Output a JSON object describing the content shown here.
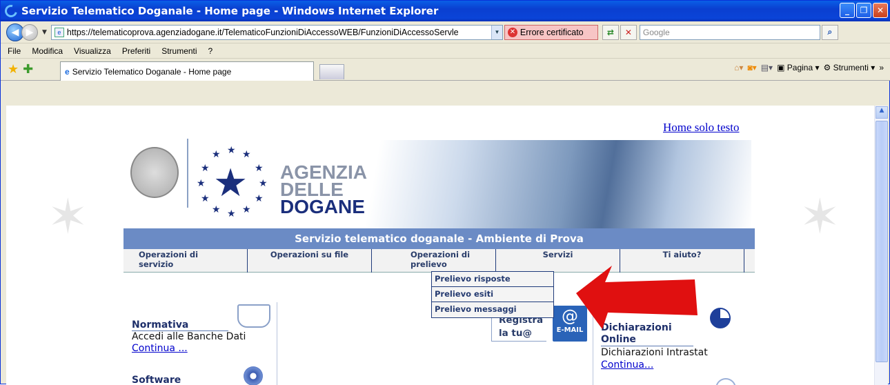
{
  "window": {
    "title": "Servizio Telematico Doganale - Home page - Windows Internet Explorer"
  },
  "address": {
    "url": "https://telematicoprova.agenziadogane.it/TelematicoFunzioniDiAccessoWEB/FunzioniDiAccessoServle",
    "cert_error": "Errore certificato",
    "search_placeholder": "Google"
  },
  "menubar": [
    "File",
    "Modifica",
    "Visualizza",
    "Preferiti",
    "Strumenti",
    "?"
  ],
  "tab": {
    "label": "Servizio Telematico Doganale - Home page"
  },
  "commandbar": {
    "page": "Pagina",
    "tools": "Strumenti"
  },
  "page": {
    "home_text_link": "Home solo testo",
    "logo": {
      "line1": "AGENZIA",
      "line2": "DELLE",
      "line3": "DOGANE"
    },
    "banner": "Servizio telematico doganale - Ambiente di Prova",
    "nav": [
      {
        "label": "Operazioni di servizio"
      },
      {
        "label": "Operazioni su file"
      },
      {
        "label": "Operazioni di prelievo"
      },
      {
        "label": "Servizi"
      },
      {
        "label": "Ti aiuto?"
      }
    ],
    "dropdown": [
      "Prelievo risposte",
      "Prelievo esiti",
      "Prelievo messaggi"
    ],
    "normativa": {
      "title": "Normativa",
      "text": "Accedi alle Banche Dati",
      "link": "Continua ..."
    },
    "software": {
      "title": "Software"
    },
    "registra": {
      "line1": "Registra",
      "line2": "la tu@",
      "email_label": "E-MAIL"
    },
    "dichiarazioni": {
      "title1": "Dichiarazioni",
      "title2": "Online",
      "text": "Dichiarazioni Intrastat",
      "link": "Continua..."
    }
  },
  "colors": {
    "banner_bg": "#6b8bc5",
    "arrow": "#e01010",
    "nav_text": "#2a3d6a"
  }
}
